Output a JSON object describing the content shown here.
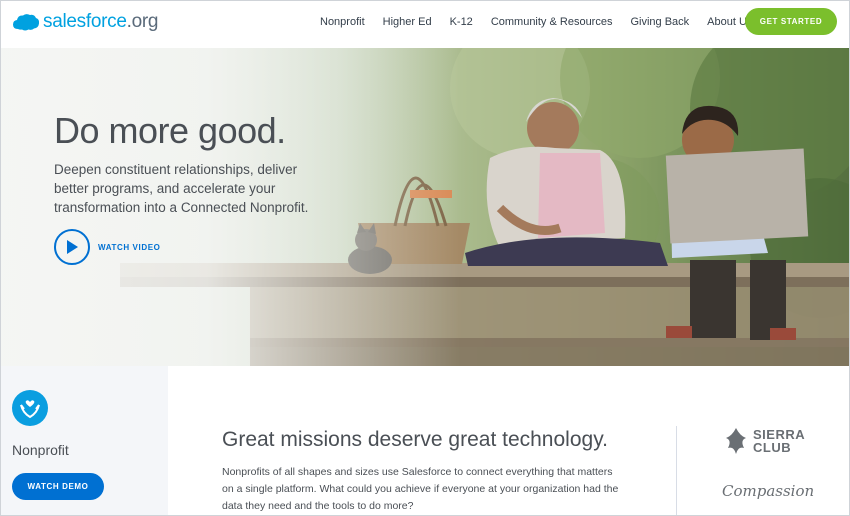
{
  "header": {
    "logo_main": "salesforce",
    "logo_suffix": ".org",
    "nav": [
      "Nonprofit",
      "Higher Ed",
      "K-12",
      "Community & Resources",
      "Giving Back",
      "About Us"
    ],
    "cta_label": "GET STARTED"
  },
  "hero": {
    "title": "Do more good.",
    "description": "Deepen constituent relationships, deliver better programs, and accelerate your transformation into a Connected Nonprofit.",
    "watch_label": "WATCH VIDEO"
  },
  "side": {
    "label": "Nonprofit",
    "demo_label": "WATCH DEMO"
  },
  "main": {
    "title": "Great missions deserve great technology.",
    "body": "Nonprofits of all shapes and sizes use Salesforce to connect everything that matters on a single platform. What could you achieve if everyone at your organization had the data they need and the tools to do more?"
  },
  "partners": {
    "sierra": "SIERRA CLUB",
    "compassion": "Compassion"
  },
  "colors": {
    "brand_blue": "#00a1e0",
    "button_blue": "#0070d2",
    "cta_green": "#7bbf2c"
  },
  "icons": [
    "salesforce-cloud-icon",
    "play-icon",
    "hands-heart-icon",
    "sierra-tree-icon"
  ]
}
